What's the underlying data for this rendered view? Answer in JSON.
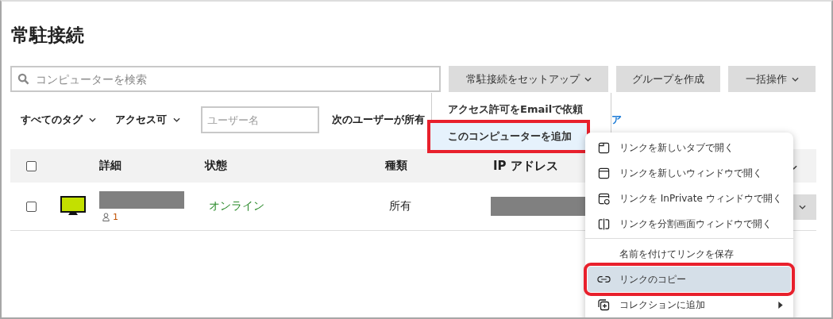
{
  "page_title": "常駐接続",
  "search": {
    "placeholder": "コンピューターを検索"
  },
  "toolbar_buttons": [
    {
      "label": "常駐接続をセットアップ",
      "caret": true
    },
    {
      "label": "グループを作成",
      "caret": false
    },
    {
      "label": "一括操作",
      "caret": true
    }
  ],
  "filters": {
    "tag_dropdown": "すべてのタグ",
    "access_dropdown": "アクセス可",
    "user_field": {
      "placeholder": "ユーザー名"
    },
    "owner_label": "次のユーザーが所有",
    "link_fragment": "ア"
  },
  "table": {
    "columns": [
      "詳細",
      "状態",
      "種類",
      "IP アドレス"
    ],
    "select_all_checked": false,
    "rows": [
      {
        "checked": false,
        "user_count": "1",
        "status": "オンライン",
        "online": true,
        "type": "所有"
      }
    ]
  },
  "setup_menu": [
    {
      "label": "アクセス許可をEmailで依頼",
      "selected": false,
      "highlighted": false
    },
    {
      "label": "このコンピューターを追加",
      "selected": true,
      "highlighted": true
    }
  ],
  "context_menu": [
    {
      "label": "リンクを新しいタブで開く",
      "kind": "tab",
      "selected": false,
      "highlighted": false,
      "divider_after": false,
      "submenu": false
    },
    {
      "label": "リンクを新しいウィンドウで開く",
      "kind": "window",
      "selected": false,
      "highlighted": false,
      "divider_after": false,
      "submenu": false
    },
    {
      "label": "リンクを InPrivate ウィンドウで開く",
      "kind": "private",
      "selected": false,
      "highlighted": false,
      "divider_after": false,
      "submenu": false
    },
    {
      "label": "リンクを分割画面ウィンドウで開く",
      "kind": "split",
      "selected": false,
      "highlighted": false,
      "divider_after": true,
      "submenu": false
    },
    {
      "label": "名前を付けてリンクを保存",
      "kind": "plain",
      "selected": false,
      "highlighted": false,
      "divider_after": false,
      "submenu": false
    },
    {
      "label": "リンクのコピー",
      "kind": "link",
      "selected": true,
      "highlighted": true,
      "divider_after": false,
      "submenu": false
    },
    {
      "label": "コレクションに追加",
      "kind": "collection",
      "selected": false,
      "highlighted": false,
      "divider_after": false,
      "submenu": true
    }
  ]
}
